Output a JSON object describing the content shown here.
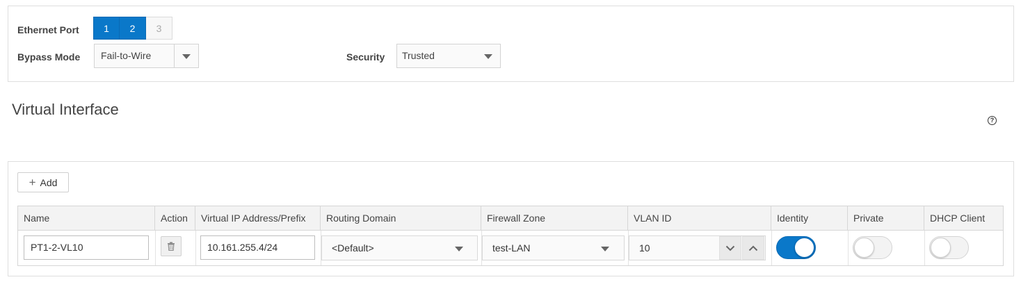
{
  "ethernet": {
    "label": "Ethernet Port",
    "ports": [
      {
        "label": "1",
        "selected": true
      },
      {
        "label": "2",
        "selected": true
      },
      {
        "label": "3",
        "selected": false
      }
    ]
  },
  "bypass": {
    "label": "Bypass Mode",
    "value": "Fail-to-Wire"
  },
  "security": {
    "label": "Security",
    "value": "Trusted"
  },
  "section": {
    "title": "Virtual Interface",
    "help_icon": "question-circle-icon",
    "help_glyph": "?"
  },
  "add_button": {
    "label": "Add",
    "icon": "plus-icon",
    "glyph": "+"
  },
  "table": {
    "columns": [
      "Name",
      "Action",
      "Virtual IP Address/Prefix",
      "Routing Domain",
      "Firewall Zone",
      "VLAN ID",
      "Identity",
      "Private",
      "DHCP Client"
    ],
    "row": {
      "name": "PT1-2-VL10",
      "action_icon": "trash-icon",
      "ip": "10.161.255.4/24",
      "routing_domain": "<Default>",
      "firewall_zone": "test-LAN",
      "vlan_id": "10",
      "identity": true,
      "private": false,
      "dhcp_client": false
    }
  },
  "colors": {
    "accent": "#0a78c9",
    "border": "#dedede"
  }
}
